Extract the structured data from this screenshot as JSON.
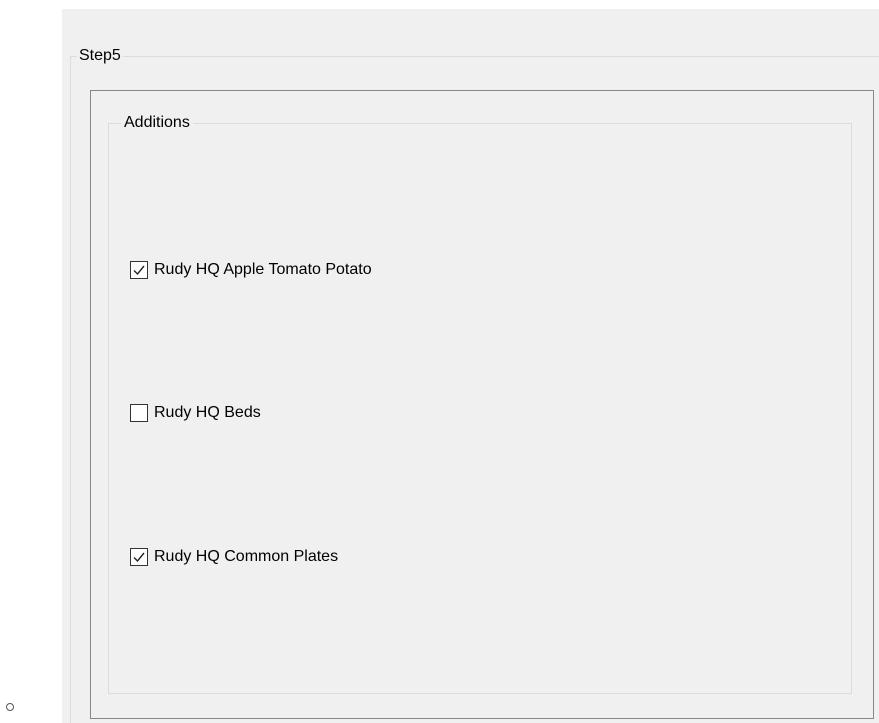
{
  "step_group": {
    "title": "Step5"
  },
  "additions_group": {
    "title": "Additions",
    "items": [
      {
        "label": "Rudy HQ Apple Tomato Potato",
        "checked": true
      },
      {
        "label": "Rudy HQ Beds",
        "checked": false
      },
      {
        "label": "Rudy HQ Common Plates",
        "checked": true
      }
    ]
  },
  "icons": {
    "checkbox_tick": "checkmark-icon"
  },
  "colors": {
    "surface": "#f0f0f0",
    "groupbox_border": "#dcdcdc",
    "panel_border": "#828790",
    "checkbox_border": "#333333"
  }
}
